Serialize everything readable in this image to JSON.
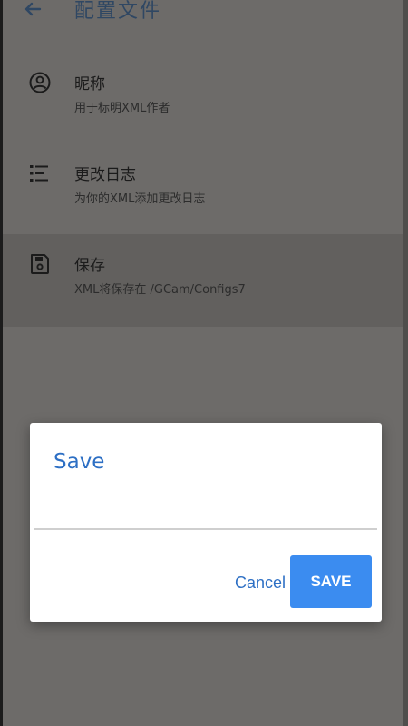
{
  "app_bar": {
    "title": "配置文件",
    "back_icon": "arrow-back-icon"
  },
  "settings": [
    {
      "icon": "person-circle-icon",
      "title": "昵称",
      "subtitle": "用于标明XML作者"
    },
    {
      "icon": "list-icon",
      "title": "更改日志",
      "subtitle": "为你的XML添加更改日志"
    },
    {
      "icon": "save-disk-icon",
      "title": "保存",
      "subtitle": "XML将保存在 /GCam/Configs7"
    }
  ],
  "dialog": {
    "title": "Save",
    "input_value": "",
    "cancel_label": "Cancel",
    "save_label": "SAVE"
  },
  "colors": {
    "accent": "#2d6fc4",
    "save_button": "#3b8cf0",
    "scrim_background": "#6d6b69"
  }
}
